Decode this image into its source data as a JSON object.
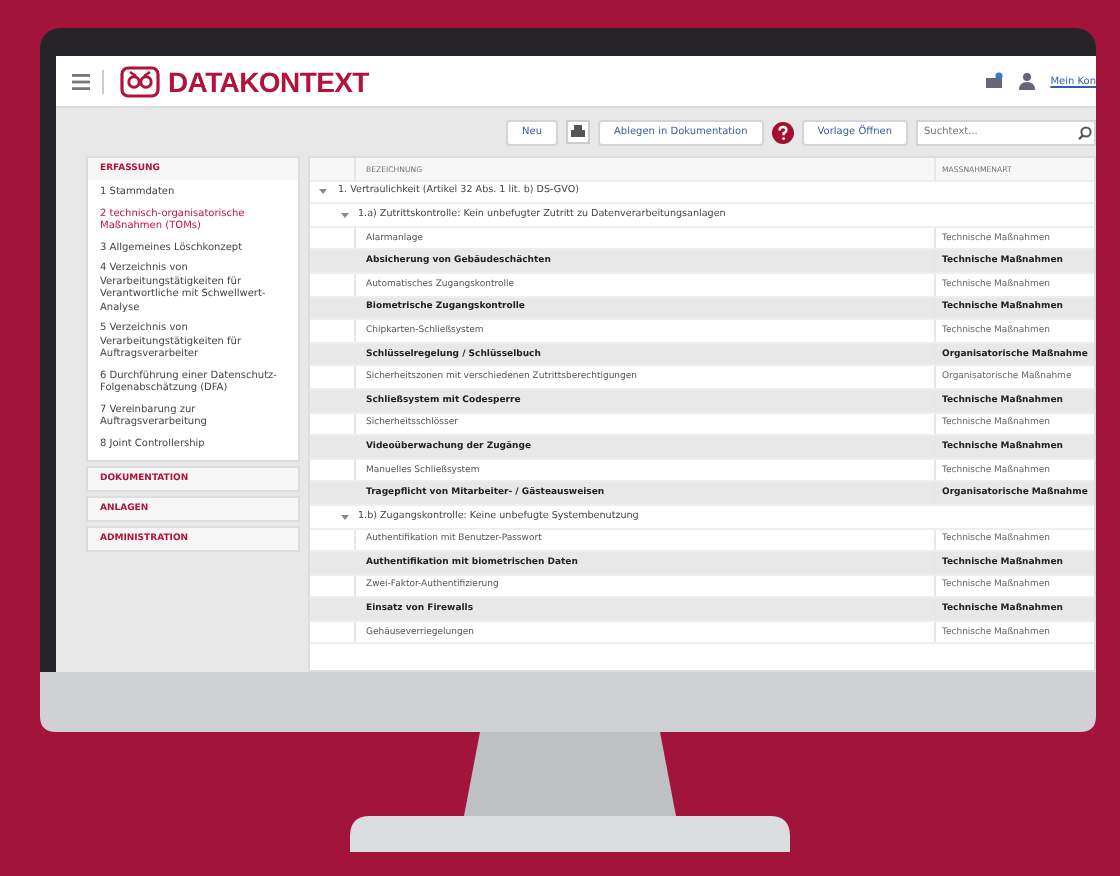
{
  "header": {
    "logo": "DATAKONTEXT",
    "account_link": "Mein Kon"
  },
  "toolbar": {
    "buttons": [
      "Neu",
      "Ablegen in Dokumentation",
      "Vorlage Öffnen"
    ],
    "search": {
      "placeholder": "Suchtext..."
    }
  },
  "sidebar": {
    "sections": [
      {
        "title": "ERFASSUNG",
        "items": [
          {
            "label": "1 Stammdaten",
            "selected": false
          },
          {
            "label": "2 technisch-organisatorische Maßnahmen (TOMs)",
            "selected": true
          },
          {
            "label": "3 Allgemeines Löschkonzept",
            "selected": false
          },
          {
            "label": "4 Verzeichnis von Verarbeitungstätigkeiten für Verantwortliche mit Schwellwert-Analyse",
            "selected": false
          },
          {
            "label": "5 Verzeichnis von Verarbeitungstätigkeiten für Auftragsverarbeiter",
            "selected": false
          },
          {
            "label": "6 Durchführung einer Datenschutz-Folgenabschätzung (DFA)",
            "selected": false
          },
          {
            "label": "7 Vereinbarung zur Auftragsverarbeitung",
            "selected": false
          },
          {
            "label": "8 Joint Controllership",
            "selected": false
          }
        ]
      },
      {
        "title": "DOKUMENTATION"
      },
      {
        "title": "ANLAGEN"
      },
      {
        "title": "ADMINISTRATION"
      }
    ]
  },
  "table": {
    "columns": [
      "BEZEICHNUNG",
      "MASSNAHMENART"
    ],
    "groups": [
      {
        "title": "1. Vertraulichkeit (Artikel 32 Abs. 1 lit. b) DS-GVO)",
        "expanded": true,
        "children": [
          {
            "title": "1.a) Zutrittskontrolle: Kein unbefugter Zutritt zu Datenverarbeitungsanlagen",
            "expanded": true,
            "rows": [
              {
                "name": "Alarmanlage",
                "type": "Technische Maßnahmen"
              },
              {
                "name": "Absicherung von Gebäudeschächten",
                "type": "Technische Maßnahmen"
              },
              {
                "name": "Automatisches Zugangskontrolle",
                "type": "Technische Maßnahmen"
              },
              {
                "name": "Biometrische Zugangskontrolle",
                "type": "Technische Maßnahmen"
              },
              {
                "name": "Chipkarten-Schließsystem",
                "type": "Technische Maßnahmen"
              },
              {
                "name": "Schlüsselregelung / Schlüsselbuch",
                "type": "Organisatorische Maßnahme"
              },
              {
                "name": "Sicherheitszonen mit verschiedenen Zutrittsberechtigungen",
                "type": "Organisatorische Maßnahme"
              },
              {
                "name": "Schließsystem mit Codesperre",
                "type": "Technische Maßnahmen"
              },
              {
                "name": "Sicherheitsschlösser",
                "type": "Technische Maßnahmen"
              },
              {
                "name": "Videoüberwachung der Zugänge",
                "type": "Technische Maßnahmen"
              },
              {
                "name": "Manuelles Schließsystem",
                "type": "Technische Maßnahmen"
              },
              {
                "name": "Tragepflicht von Mitarbeiter- / Gästeausweisen",
                "type": "Organisatorische Maßnahme"
              }
            ]
          },
          {
            "title": "1.b) Zugangskontrolle: Keine unbefugte Systembenutzung",
            "expanded": true,
            "rows": [
              {
                "name": "Authentifikation mit Benutzer-Passwort",
                "type": "Technische Maßnahmen"
              },
              {
                "name": "Authentifikation mit biometrischen Daten",
                "type": "Technische Maßnahmen"
              },
              {
                "name": "Zwei-Faktor-Authentifizierung",
                "type": "Technische Maßnahmen"
              },
              {
                "name": "Einsatz von Firewalls",
                "type": "Technische Maßnahmen"
              },
              {
                "name": "Gehäuseverriegelungen",
                "type": "Technische Maßnahmen"
              }
            ]
          }
        ]
      }
    ]
  }
}
